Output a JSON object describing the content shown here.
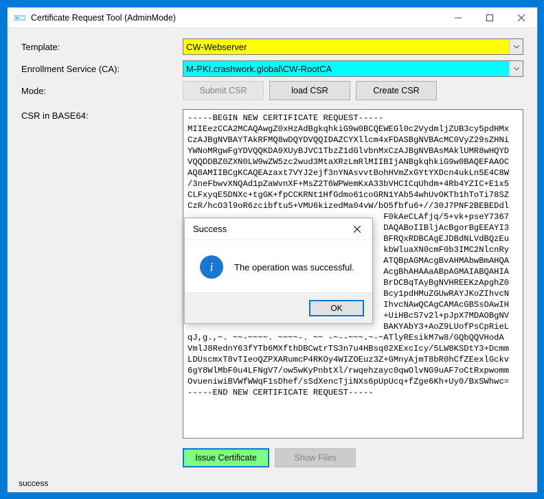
{
  "window": {
    "title": "Certificate Request Tool (AdminMode)"
  },
  "labels": {
    "template": "Template:",
    "enrollment": "Enrollment Service (CA):",
    "mode": "Mode:",
    "csr": "CSR in BASE64:"
  },
  "fields": {
    "template_value": "CW-Webserver",
    "enrollment_value": "M-PKI.crashwork.global\\CW-RootCA"
  },
  "buttons": {
    "submit_csr": "Submit CSR",
    "load_csr": "load CSR",
    "create_csr": "Create CSR",
    "issue_cert": "Issue Certificate",
    "show_files": "Show Files"
  },
  "csr_text": "-----BEGIN NEW CERTIFICATE REQUEST-----\nMIIEezCCA2MCAQAwgZ0xHzAdBgkqhkiG9w0BCQEWEGl0c2VydmljZUB3cy5pdHMx\nCzAJBgNVBAYTAkRFMQ8wDQYDVQQIDAZCYXllcm4xFDASBgNVBAcMC0VyZ29sZHNi\nYWNoMRgwFgYDVQQKDA9XUyBJVC1TbzZ1dGlvbnMxCzAJBgNVBAsMAklUMR8wHQYD\nVQQDDBZ0ZXN0LW9wZW5zc2wud3MtaXRzLmRlMIIBIjANBgkqhkiG9w0BAQEFAAOC\nAQ8AMIIBCgKCAQEAzaxt7VYJ2ejf3nYNAsvvtBohHVmZxGYtYXDcn4ukLn5E4C8W\n/3neFbwvXNQAd1pZaWvnXF+MsZ2T6WPWemKxA33bVHCICqUhdm+4Rb4YZIC+E1x5\nCLFxyqE5DNXc+tgGK+fpCCKRNt1HfGdmo61coGRN1YAb54whUvOKTb1hToTi78SZ\nCzR/hcO3l9oR6zcibftu5+VMU6kizedMa04vW/bO5fbfu6+//30J7PNF2BEBEDdl\n                                       F0kAeCLAfjq/5+vk+pseY7367\n                                       DAQABoIIBljAcBgorBgEEAYI3\n                                       BFRQxRDBCAgEJDBdNLVdBQzEu\n                                       kbWluaXN0cmF0b3IMC2NlcnRy\n                                       ATQBpAGMAcgBvAHMAbwBmAHQA\n                                       AcgBhAHAAaABpAGMAIABQAHIA\n                                       BrDCBqTAyBgNVHREEKzApghZ0\n                                       Bcy1pdHMuZGUwRAYJKoZIhvcN\n                                       IhvcNAwQCAgCAMAcGBSsOAwIH\n                                       +UiHBcS7v2l+pJpX7MDAOBgNV\n                                       BAKYAbY3+AoZ9LUofPsCpRieL\nqJ,g.,~. ~~-~~~~. ~~~~-. ~~ -~--~~~.~-~ATlyREsikM7w8/GQbQQVHodA\nVmlJ8RednY63fYTb6MXfthDBCwtrTS3n7u4HBsq02XExcIcy/5LW8KSDtY3+Dcmm\nLDUscmxT8vTIeoQZPXARumcP4RKOy4WIZOEuz3Z+GMnyAjmT8bR0hCfZEexlGckv\n6gY8WlMbF0u4LFNgV7/ow5wKyPnbtXl/rwqehzayc0qwOlvNG9uAF7oCtRxpwomm\nOvueniwiBVWfWWqF1sDhef/sSdXencTjiNXs6pUpUcq+fZge6Kh+Uy0/BxSWhwc=\n-----END NEW CERTIFICATE REQUEST-----",
  "dialog": {
    "title": "Success",
    "message": "The operation was successful.",
    "ok": "OK"
  },
  "status": "success"
}
